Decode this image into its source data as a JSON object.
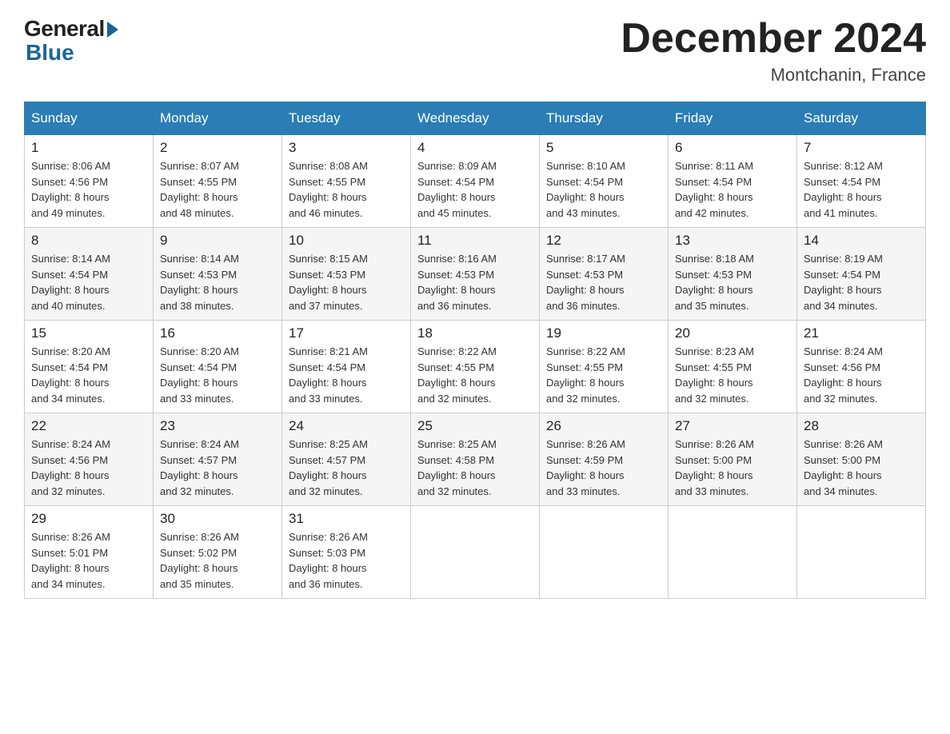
{
  "header": {
    "logo_general": "General",
    "logo_blue": "Blue",
    "month_title": "December 2024",
    "location": "Montchanin, France"
  },
  "days_of_week": [
    "Sunday",
    "Monday",
    "Tuesday",
    "Wednesday",
    "Thursday",
    "Friday",
    "Saturday"
  ],
  "weeks": [
    [
      {
        "day": "1",
        "sunrise": "8:06 AM",
        "sunset": "4:56 PM",
        "daylight": "8 hours and 49 minutes."
      },
      {
        "day": "2",
        "sunrise": "8:07 AM",
        "sunset": "4:55 PM",
        "daylight": "8 hours and 48 minutes."
      },
      {
        "day": "3",
        "sunrise": "8:08 AM",
        "sunset": "4:55 PM",
        "daylight": "8 hours and 46 minutes."
      },
      {
        "day": "4",
        "sunrise": "8:09 AM",
        "sunset": "4:54 PM",
        "daylight": "8 hours and 45 minutes."
      },
      {
        "day": "5",
        "sunrise": "8:10 AM",
        "sunset": "4:54 PM",
        "daylight": "8 hours and 43 minutes."
      },
      {
        "day": "6",
        "sunrise": "8:11 AM",
        "sunset": "4:54 PM",
        "daylight": "8 hours and 42 minutes."
      },
      {
        "day": "7",
        "sunrise": "8:12 AM",
        "sunset": "4:54 PM",
        "daylight": "8 hours and 41 minutes."
      }
    ],
    [
      {
        "day": "8",
        "sunrise": "8:14 AM",
        "sunset": "4:54 PM",
        "daylight": "8 hours and 40 minutes."
      },
      {
        "day": "9",
        "sunrise": "8:14 AM",
        "sunset": "4:53 PM",
        "daylight": "8 hours and 38 minutes."
      },
      {
        "day": "10",
        "sunrise": "8:15 AM",
        "sunset": "4:53 PM",
        "daylight": "8 hours and 37 minutes."
      },
      {
        "day": "11",
        "sunrise": "8:16 AM",
        "sunset": "4:53 PM",
        "daylight": "8 hours and 36 minutes."
      },
      {
        "day": "12",
        "sunrise": "8:17 AM",
        "sunset": "4:53 PM",
        "daylight": "8 hours and 36 minutes."
      },
      {
        "day": "13",
        "sunrise": "8:18 AM",
        "sunset": "4:53 PM",
        "daylight": "8 hours and 35 minutes."
      },
      {
        "day": "14",
        "sunrise": "8:19 AM",
        "sunset": "4:54 PM",
        "daylight": "8 hours and 34 minutes."
      }
    ],
    [
      {
        "day": "15",
        "sunrise": "8:20 AM",
        "sunset": "4:54 PM",
        "daylight": "8 hours and 34 minutes."
      },
      {
        "day": "16",
        "sunrise": "8:20 AM",
        "sunset": "4:54 PM",
        "daylight": "8 hours and 33 minutes."
      },
      {
        "day": "17",
        "sunrise": "8:21 AM",
        "sunset": "4:54 PM",
        "daylight": "8 hours and 33 minutes."
      },
      {
        "day": "18",
        "sunrise": "8:22 AM",
        "sunset": "4:55 PM",
        "daylight": "8 hours and 32 minutes."
      },
      {
        "day": "19",
        "sunrise": "8:22 AM",
        "sunset": "4:55 PM",
        "daylight": "8 hours and 32 minutes."
      },
      {
        "day": "20",
        "sunrise": "8:23 AM",
        "sunset": "4:55 PM",
        "daylight": "8 hours and 32 minutes."
      },
      {
        "day": "21",
        "sunrise": "8:24 AM",
        "sunset": "4:56 PM",
        "daylight": "8 hours and 32 minutes."
      }
    ],
    [
      {
        "day": "22",
        "sunrise": "8:24 AM",
        "sunset": "4:56 PM",
        "daylight": "8 hours and 32 minutes."
      },
      {
        "day": "23",
        "sunrise": "8:24 AM",
        "sunset": "4:57 PM",
        "daylight": "8 hours and 32 minutes."
      },
      {
        "day": "24",
        "sunrise": "8:25 AM",
        "sunset": "4:57 PM",
        "daylight": "8 hours and 32 minutes."
      },
      {
        "day": "25",
        "sunrise": "8:25 AM",
        "sunset": "4:58 PM",
        "daylight": "8 hours and 32 minutes."
      },
      {
        "day": "26",
        "sunrise": "8:26 AM",
        "sunset": "4:59 PM",
        "daylight": "8 hours and 33 minutes."
      },
      {
        "day": "27",
        "sunrise": "8:26 AM",
        "sunset": "5:00 PM",
        "daylight": "8 hours and 33 minutes."
      },
      {
        "day": "28",
        "sunrise": "8:26 AM",
        "sunset": "5:00 PM",
        "daylight": "8 hours and 34 minutes."
      }
    ],
    [
      {
        "day": "29",
        "sunrise": "8:26 AM",
        "sunset": "5:01 PM",
        "daylight": "8 hours and 34 minutes."
      },
      {
        "day": "30",
        "sunrise": "8:26 AM",
        "sunset": "5:02 PM",
        "daylight": "8 hours and 35 minutes."
      },
      {
        "day": "31",
        "sunrise": "8:26 AM",
        "sunset": "5:03 PM",
        "daylight": "8 hours and 36 minutes."
      },
      null,
      null,
      null,
      null
    ]
  ],
  "labels": {
    "sunrise": "Sunrise:",
    "sunset": "Sunset:",
    "daylight": "Daylight:"
  }
}
